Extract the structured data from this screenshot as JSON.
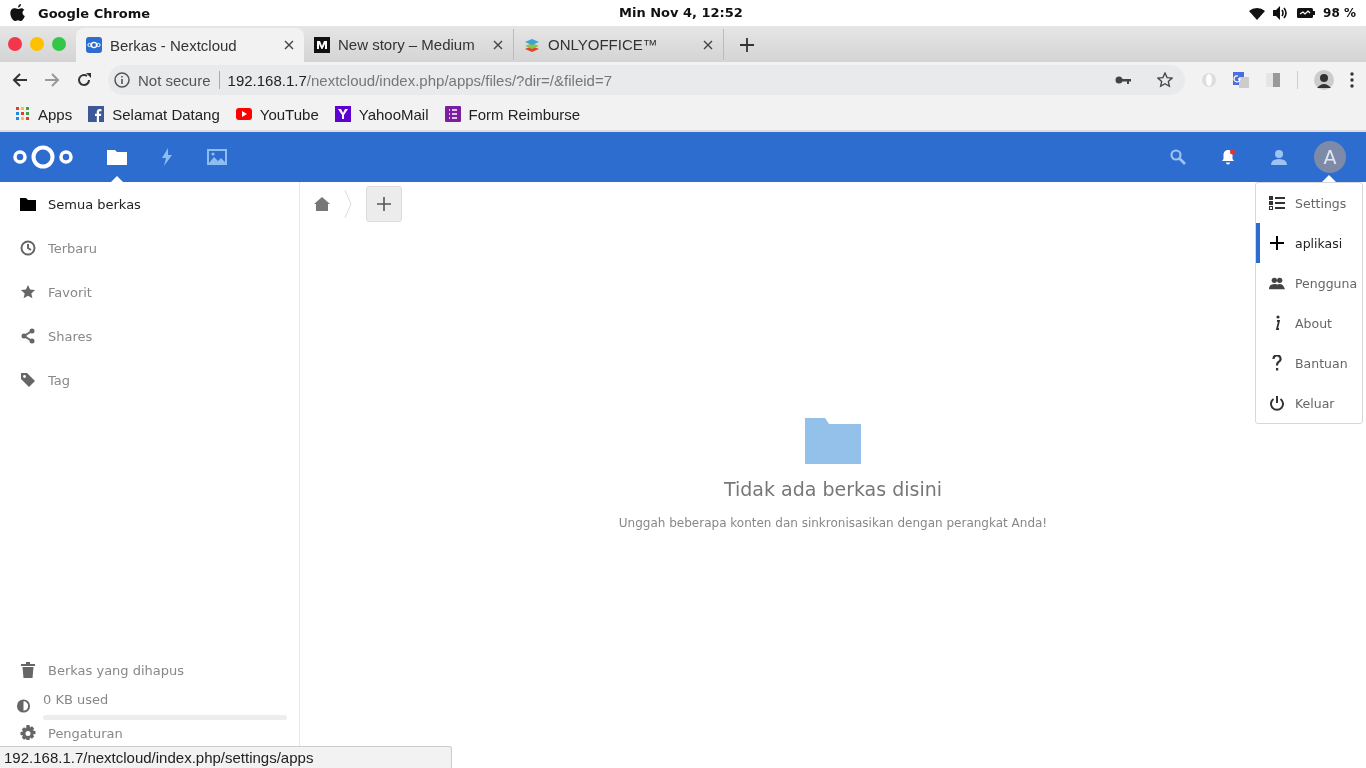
{
  "system_bar": {
    "app_name": "Google Chrome",
    "clock": "Min Nov  4, 12:52",
    "battery": "98 %"
  },
  "browser": {
    "tabs": [
      {
        "title": "Berkas - Nextcloud",
        "kind": "nextcloud",
        "selected": true
      },
      {
        "title": "New story – Medium",
        "kind": "medium",
        "selected": false
      },
      {
        "title": "ONLYOFFICE™",
        "kind": "layers",
        "selected": false
      }
    ],
    "address": {
      "security": "Not secure",
      "host": "192.168.1.7",
      "path": "/nextcloud/index.php/apps/files/?dir=/&fileid=7"
    },
    "bookmarks": [
      {
        "label": "Apps",
        "kind": "grid"
      },
      {
        "label": "Selamat Datang",
        "kind": "facebook"
      },
      {
        "label": "YouTube",
        "kind": "youtube"
      },
      {
        "label": "YahooMail",
        "kind": "yahoo"
      },
      {
        "label": "Form Reimburse",
        "kind": "form"
      }
    ]
  },
  "header": {
    "apps": [
      {
        "kind": "files",
        "selected": true
      },
      {
        "kind": "activity",
        "selected": false
      },
      {
        "kind": "gallery",
        "selected": false
      }
    ],
    "notifications_unread": true,
    "avatar": "A"
  },
  "sidebar": {
    "items": [
      {
        "label": "Semua berkas",
        "kind": "folder",
        "selected": true
      },
      {
        "label": "Terbaru",
        "kind": "clock",
        "selected": false
      },
      {
        "label": "Favorit",
        "kind": "star",
        "selected": false
      },
      {
        "label": "Shares",
        "kind": "share",
        "selected": false
      },
      {
        "label": "Tag",
        "kind": "tag",
        "selected": false
      }
    ],
    "trash": "Berkas yang dihapus",
    "quota": {
      "text": "0 KB used",
      "level": 0
    },
    "settings": "Pengaturan"
  },
  "empty": {
    "title": "Tidak ada berkas disini",
    "subtitle": "Unggah beberapa konten dan sinkronisasikan dengan perangkat Anda!"
  },
  "menu": {
    "items": [
      {
        "label": "Settings",
        "kind": "list",
        "selected": false
      },
      {
        "label": "aplikasi",
        "kind": "plus",
        "selected": true
      },
      {
        "label": "Pengguna",
        "kind": "users",
        "selected": false
      },
      {
        "label": "About",
        "kind": "info",
        "selected": false
      },
      {
        "label": "Bantuan",
        "kind": "help",
        "selected": false
      },
      {
        "label": "Keluar",
        "kind": "power",
        "selected": false
      }
    ]
  },
  "status_url": "192.168.1.7/nextcloud/index.php/settings/apps"
}
